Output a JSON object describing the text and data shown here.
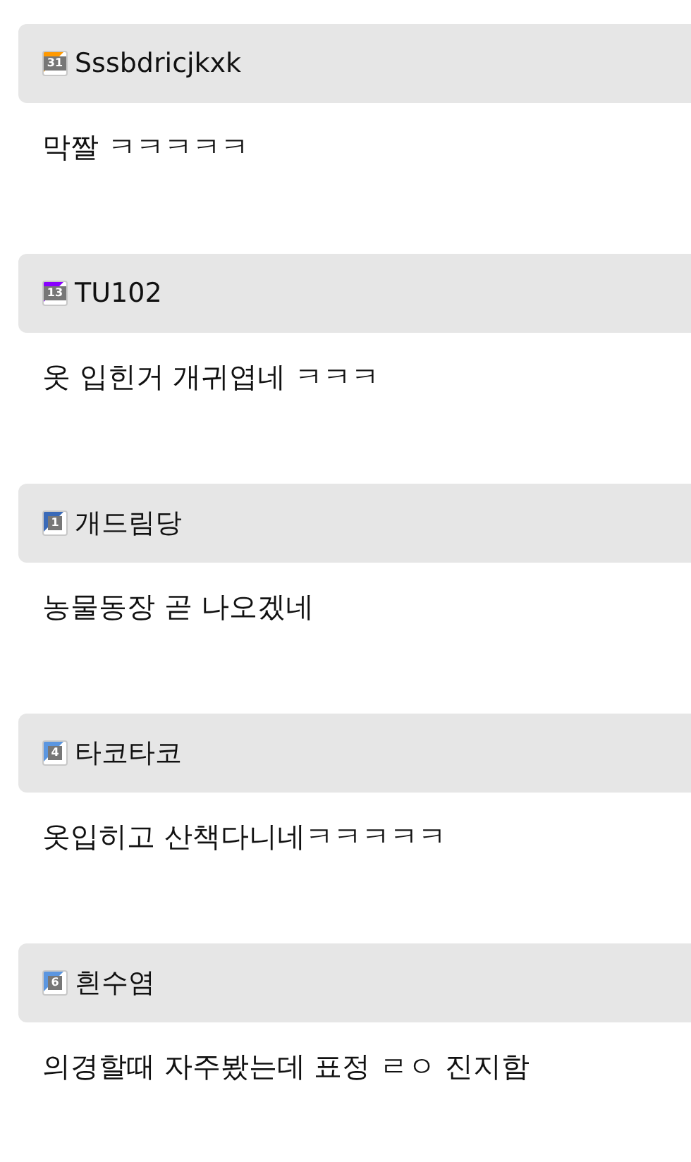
{
  "comments": [
    {
      "level": "31",
      "color": "#ff9900",
      "name": "Sssbdricjkxk",
      "text": "막짤 ㅋㅋㅋㅋㅋ"
    },
    {
      "level": "13",
      "color": "#8800ff",
      "name": "TU102",
      "text": "옷 입힌거 개귀엽네 ㅋㅋㅋ"
    },
    {
      "level": "1",
      "color": "#3a6ab8",
      "name": "개드림당",
      "text": "농물동장 곧 나오겠네"
    },
    {
      "level": "4",
      "color": "#5b96e0",
      "name": "타코타코",
      "text": "옷입히고 산책다니네ㅋㅋㅋㅋㅋ"
    },
    {
      "level": "6",
      "color": "#5b96e0",
      "name": "흰수염",
      "text": "의경할때 자주봤는데 표정 ㄹㅇ 진지함"
    }
  ]
}
